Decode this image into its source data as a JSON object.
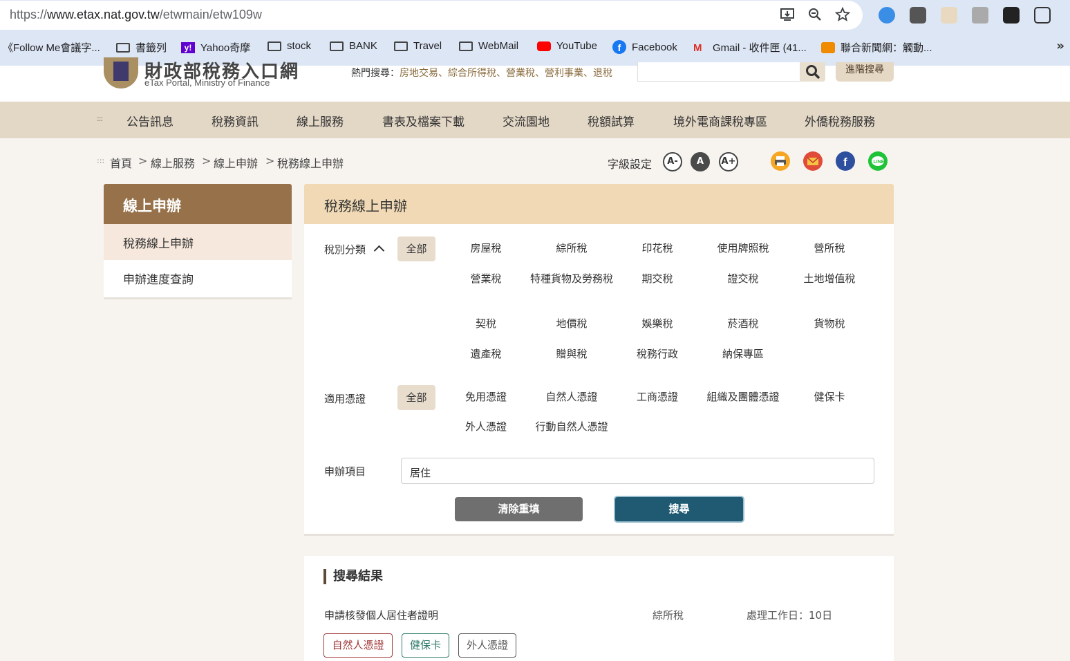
{
  "browser": {
    "url_prefix": "https://",
    "url_host": "www.etax.nat.gov.tw",
    "url_path": "/etwmain/etw109w",
    "bookmarks": [
      {
        "label": "《Follow Me會議字..."
      },
      {
        "label": "書籤列"
      },
      {
        "label": "Yahoo奇摩"
      },
      {
        "label": "stock"
      },
      {
        "label": "BANK"
      },
      {
        "label": "Travel"
      },
      {
        "label": "WebMail"
      },
      {
        "label": "YouTube"
      },
      {
        "label": "Facebook"
      },
      {
        "label": "Gmail - 收件匣 (41..."
      },
      {
        "label": "聯合新聞網：觸動..."
      }
    ],
    "more": "»"
  },
  "header": {
    "logo_title": "財政部稅務入口網",
    "logo_sub": "eTax Portal, Ministry of Finance",
    "hot_label": "熱門搜尋：",
    "hot_keywords": "房地交易、綜合所得稅、營業稅、營利事業、退稅",
    "advanced_search": "進階搜尋"
  },
  "nav": {
    "dots": ":::",
    "items": [
      "公告訊息",
      "稅務資訊",
      "線上服務",
      "書表及檔案下載",
      "交流園地",
      "稅額試算",
      "境外電商課稅專區",
      "外僑稅務服務"
    ]
  },
  "breadcrumb": {
    "dots": ":::",
    "items": [
      "首頁",
      "線上服務",
      "線上申辦",
      "稅務線上申辦"
    ],
    "sep": ">"
  },
  "font_size": {
    "label": "字級設定",
    "small": "A-",
    "normal": "A",
    "large": "A+"
  },
  "sidebar": {
    "title": "線上申辦",
    "items": [
      "稅務線上申辦",
      "申辦進度查詢"
    ]
  },
  "panel": {
    "title": "稅務線上申辦",
    "tax_label": "稅別分類",
    "all_label": "全部",
    "tax_options": [
      "房屋稅",
      "綜所稅",
      "印花稅",
      "使用牌照稅",
      "營所稅",
      "營業稅",
      "特種貨物及勞務稅",
      "期交稅",
      "證交稅",
      "土地增值稅",
      "契稅",
      "地價稅",
      "娛樂稅",
      "菸酒稅",
      "貨物稅",
      "遺產稅",
      "贈與稅",
      "稅務行政",
      "納保專區"
    ],
    "cert_label": "適用憑證",
    "cert_options": [
      "免用憑證",
      "自然人憑證",
      "工商憑證",
      "組織及團體憑證",
      "健保卡",
      "外人憑證",
      "行動自然人憑證"
    ],
    "item_label": "申辦項目",
    "item_value": "居住",
    "clear_button": "清除重填",
    "search_button": "搜尋"
  },
  "results": {
    "title": "搜尋結果",
    "rows": [
      {
        "name": "申請核發個人居住者證明",
        "tax": "綜所稅",
        "days": "處理工作日：10日",
        "tags": [
          "自然人憑證",
          "健保卡",
          "外人憑證"
        ]
      }
    ]
  },
  "colors": {
    "nav_bg": "#e3d7c6",
    "sidebar_head": "#96714a",
    "panel_head": "#f0d9b4",
    "search_button": "#1f5a72",
    "clear_button": "#6f6f6f"
  }
}
